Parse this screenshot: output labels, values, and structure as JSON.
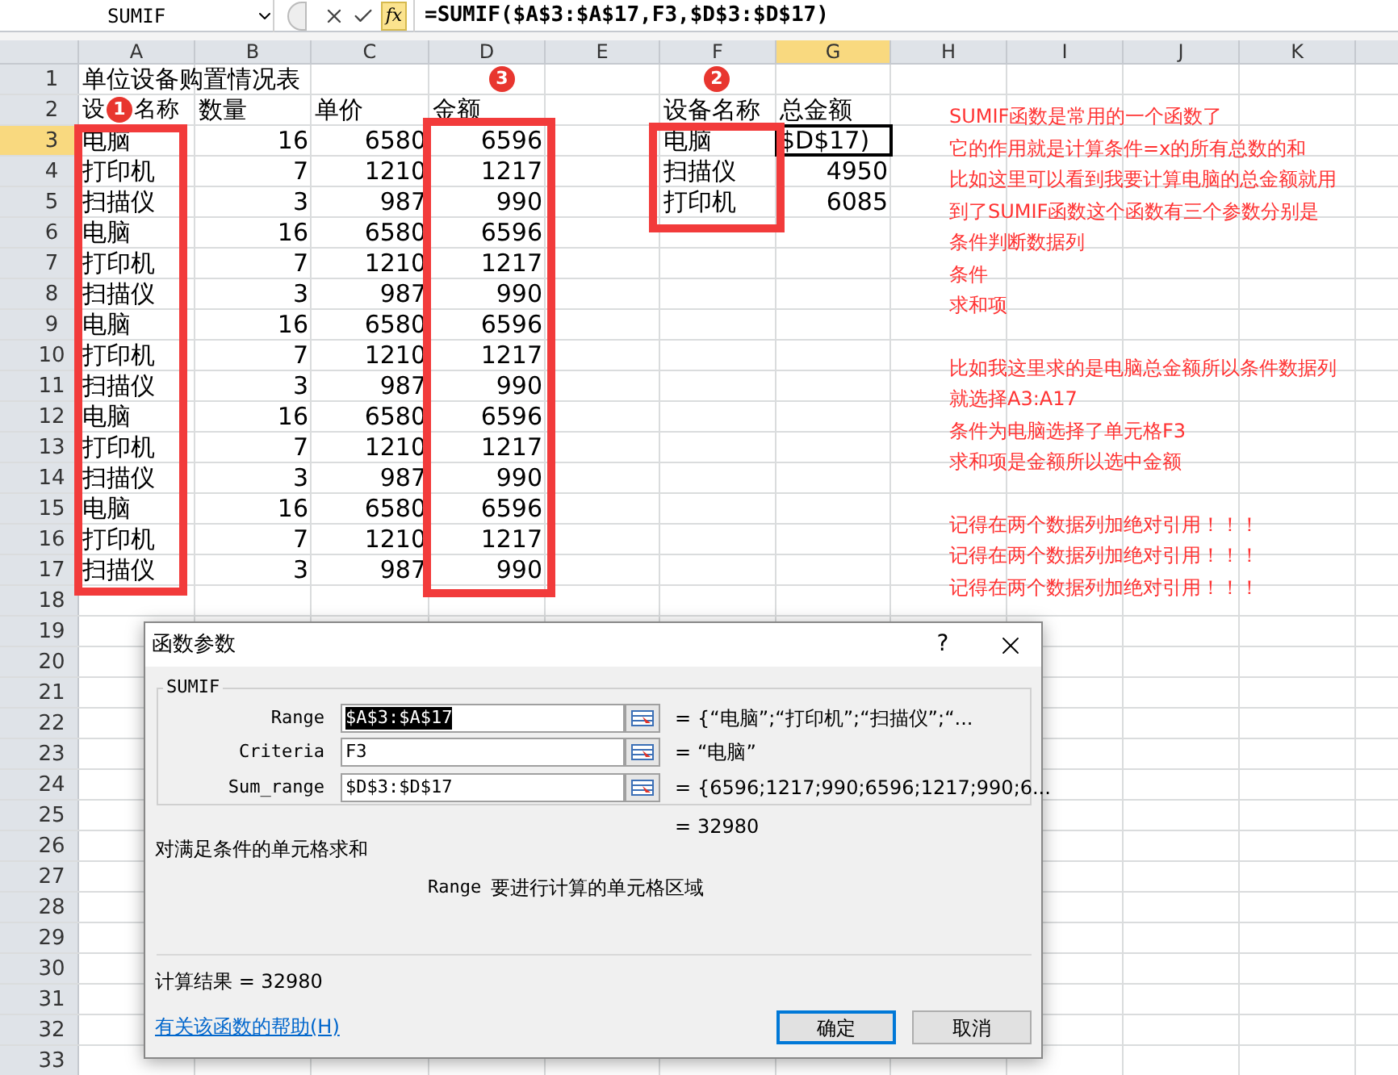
{
  "formula_bar": {
    "name_box": "SUMIF",
    "function_button": "fx",
    "formula": "=SUMIF($A$3:$A$17,F3,$D$3:$D$17)"
  },
  "sheet": {
    "columns": [
      {
        "label": "A",
        "selected": false
      },
      {
        "label": "B",
        "selected": false
      },
      {
        "label": "C",
        "selected": false
      },
      {
        "label": "D",
        "selected": false
      },
      {
        "label": "E",
        "selected": false
      },
      {
        "label": "F",
        "selected": false
      },
      {
        "label": "G",
        "selected": true
      },
      {
        "label": "H",
        "selected": false
      },
      {
        "label": "I",
        "selected": false
      },
      {
        "label": "J",
        "selected": false
      },
      {
        "label": "K",
        "selected": false
      }
    ],
    "rows": [
      {
        "number": "1",
        "selected": false,
        "A": {
          "kind": "text",
          "parts": [
            "单位设备购置情况表"
          ]
        }
      },
      {
        "number": "2",
        "selected": false,
        "A": {
          "kind": "text",
          "parts": [
            "设",
            "名称"
          ]
        },
        "B": {
          "kind": "text",
          "parts": [
            "数量"
          ]
        },
        "C": {
          "kind": "text",
          "parts": [
            "单价"
          ]
        },
        "D": {
          "kind": "text",
          "parts": [
            "金额"
          ]
        },
        "F": {
          "kind": "text",
          "parts": [
            "设备名称"
          ]
        },
        "G": {
          "kind": "text",
          "parts": [
            "总金额"
          ]
        }
      },
      {
        "number": "3",
        "selected": true,
        "A": {
          "kind": "text",
          "parts": [
            "电脑"
          ]
        },
        "B": {
          "kind": "number",
          "parts": [
            "16"
          ]
        },
        "C": {
          "kind": "number",
          "parts": [
            "6580"
          ]
        },
        "D": {
          "kind": "number",
          "parts": [
            "6596"
          ]
        },
        "F": {
          "kind": "text",
          "parts": [
            "电脑"
          ]
        },
        "G": {
          "kind": "text",
          "parts": [
            "$D$17)"
          ],
          "active": true
        }
      },
      {
        "number": "4",
        "selected": false,
        "A": {
          "kind": "text",
          "parts": [
            "打印机"
          ]
        },
        "B": {
          "kind": "number",
          "parts": [
            "7"
          ]
        },
        "C": {
          "kind": "number",
          "parts": [
            "1210"
          ]
        },
        "D": {
          "kind": "number",
          "parts": [
            "1217"
          ]
        },
        "F": {
          "kind": "text",
          "parts": [
            "扫描仪"
          ]
        },
        "G": {
          "kind": "number",
          "parts": [
            "4950"
          ]
        }
      },
      {
        "number": "5",
        "selected": false,
        "A": {
          "kind": "text",
          "parts": [
            "扫描仪"
          ]
        },
        "B": {
          "kind": "number",
          "parts": [
            "3"
          ]
        },
        "C": {
          "kind": "number",
          "parts": [
            "987"
          ]
        },
        "D": {
          "kind": "number",
          "parts": [
            "990"
          ]
        },
        "F": {
          "kind": "text",
          "parts": [
            "打印机"
          ]
        },
        "G": {
          "kind": "number",
          "parts": [
            "6085"
          ]
        }
      },
      {
        "number": "6",
        "selected": false,
        "A": {
          "kind": "text",
          "parts": [
            "电脑"
          ]
        },
        "B": {
          "kind": "number",
          "parts": [
            "16"
          ]
        },
        "C": {
          "kind": "number",
          "parts": [
            "6580"
          ]
        },
        "D": {
          "kind": "number",
          "parts": [
            "6596"
          ]
        }
      },
      {
        "number": "7",
        "selected": false,
        "A": {
          "kind": "text",
          "parts": [
            "打印机"
          ]
        },
        "B": {
          "kind": "number",
          "parts": [
            "7"
          ]
        },
        "C": {
          "kind": "number",
          "parts": [
            "1210"
          ]
        },
        "D": {
          "kind": "number",
          "parts": [
            "1217"
          ]
        }
      },
      {
        "number": "8",
        "selected": false,
        "A": {
          "kind": "text",
          "parts": [
            "扫描仪"
          ]
        },
        "B": {
          "kind": "number",
          "parts": [
            "3"
          ]
        },
        "C": {
          "kind": "number",
          "parts": [
            "987"
          ]
        },
        "D": {
          "kind": "number",
          "parts": [
            "990"
          ]
        }
      },
      {
        "number": "9",
        "selected": false,
        "A": {
          "kind": "text",
          "parts": [
            "电脑"
          ]
        },
        "B": {
          "kind": "number",
          "parts": [
            "16"
          ]
        },
        "C": {
          "kind": "number",
          "parts": [
            "6580"
          ]
        },
        "D": {
          "kind": "number",
          "parts": [
            "6596"
          ]
        }
      },
      {
        "number": "10",
        "selected": false,
        "A": {
          "kind": "text",
          "parts": [
            "打印机"
          ]
        },
        "B": {
          "kind": "number",
          "parts": [
            "7"
          ]
        },
        "C": {
          "kind": "number",
          "parts": [
            "1210"
          ]
        },
        "D": {
          "kind": "number",
          "parts": [
            "1217"
          ]
        }
      },
      {
        "number": "11",
        "selected": false,
        "A": {
          "kind": "text",
          "parts": [
            "扫描仪"
          ]
        },
        "B": {
          "kind": "number",
          "parts": [
            "3"
          ]
        },
        "C": {
          "kind": "number",
          "parts": [
            "987"
          ]
        },
        "D": {
          "kind": "number",
          "parts": [
            "990"
          ]
        }
      },
      {
        "number": "12",
        "selected": false,
        "A": {
          "kind": "text",
          "parts": [
            "电脑"
          ]
        },
        "B": {
          "kind": "number",
          "parts": [
            "16"
          ]
        },
        "C": {
          "kind": "number",
          "parts": [
            "6580"
          ]
        },
        "D": {
          "kind": "number",
          "parts": [
            "6596"
          ]
        }
      },
      {
        "number": "13",
        "selected": false,
        "A": {
          "kind": "text",
          "parts": [
            "打印机"
          ]
        },
        "B": {
          "kind": "number",
          "parts": [
            "7"
          ]
        },
        "C": {
          "kind": "number",
          "parts": [
            "1210"
          ]
        },
        "D": {
          "kind": "number",
          "parts": [
            "1217"
          ]
        }
      },
      {
        "number": "14",
        "selected": false,
        "A": {
          "kind": "text",
          "parts": [
            "扫描仪"
          ]
        },
        "B": {
          "kind": "number",
          "parts": [
            "3"
          ]
        },
        "C": {
          "kind": "number",
          "parts": [
            "987"
          ]
        },
        "D": {
          "kind": "number",
          "parts": [
            "990"
          ]
        }
      },
      {
        "number": "15",
        "selected": false,
        "A": {
          "kind": "text",
          "parts": [
            "电脑"
          ]
        },
        "B": {
          "kind": "number",
          "parts": [
            "16"
          ]
        },
        "C": {
          "kind": "number",
          "parts": [
            "6580"
          ]
        },
        "D": {
          "kind": "number",
          "parts": [
            "6596"
          ]
        }
      },
      {
        "number": "16",
        "selected": false,
        "A": {
          "kind": "text",
          "parts": [
            "打印机"
          ]
        },
        "B": {
          "kind": "number",
          "parts": [
            "7"
          ]
        },
        "C": {
          "kind": "number",
          "parts": [
            "1210"
          ]
        },
        "D": {
          "kind": "number",
          "parts": [
            "1217"
          ]
        }
      },
      {
        "number": "17",
        "selected": false,
        "A": {
          "kind": "text",
          "parts": [
            "扫描仪"
          ]
        },
        "B": {
          "kind": "number",
          "parts": [
            "3"
          ]
        },
        "C": {
          "kind": "number",
          "parts": [
            "987"
          ]
        },
        "D": {
          "kind": "number",
          "parts": [
            "990"
          ]
        }
      },
      {
        "number": "18",
        "selected": false
      },
      {
        "number": "19",
        "selected": false
      },
      {
        "number": "20",
        "selected": false
      },
      {
        "number": "21",
        "selected": false
      },
      {
        "number": "22",
        "selected": false
      },
      {
        "number": "23",
        "selected": false
      },
      {
        "number": "24",
        "selected": false
      },
      {
        "number": "25",
        "selected": false
      },
      {
        "number": "26",
        "selected": false
      },
      {
        "number": "27",
        "selected": false
      },
      {
        "number": "28",
        "selected": false
      },
      {
        "number": "29",
        "selected": false
      },
      {
        "number": "30",
        "selected": false
      },
      {
        "number": "31",
        "selected": false
      },
      {
        "number": "32",
        "selected": false
      },
      {
        "number": "33",
        "selected": false
      }
    ]
  },
  "markers": [
    {
      "label": "1"
    },
    {
      "label": "3"
    },
    {
      "label": "2"
    }
  ],
  "note": {
    "paragraphs": [
      [
        "SUMIF函数是常用的一个函数了",
        "它的作用就是计算条件=x的所有总数的和",
        "比如这里可以看到我要计算电脑的总金额就用",
        "到了SUMIF函数这个函数有三个参数分别是",
        "条件判断数据列",
        "条件",
        "求和项"
      ],
      [
        "比如我这里求的是电脑总金额所以条件数据列",
        "就选择A3:A17",
        "条件为电脑选择了单元格F3",
        "求和项是金额所以选中金额"
      ],
      [
        "记得在两个数据列加绝对引用！！！",
        "记得在两个数据列加绝对引用！！！",
        "记得在两个数据列加绝对引用！！！"
      ]
    ]
  },
  "dialog": {
    "title": "函数参数",
    "help_button": "?",
    "function_name": "SUMIF",
    "arguments": [
      {
        "label": "Range",
        "value": "$A$3:$A$17",
        "text_selected": true,
        "equals": "=",
        "result": "{“电脑”;“打印机”;“扫描仪”;“..."
      },
      {
        "label": "Criteria",
        "value": "F3",
        "text_selected": false,
        "equals": "=",
        "result": "“电脑”"
      },
      {
        "label": "Sum_range",
        "value": "$D$3:$D$17",
        "text_selected": false,
        "equals": "=",
        "result": "{6596;1217;990;6596;1217;990;6..."
      }
    ],
    "total_equals": "=",
    "total": "32980",
    "description": "对满足条件的单元格求和",
    "argument_help": {
      "name": "Range",
      "text": "要进行计算的单元格区域"
    },
    "result_line": "计算结果 = 32980",
    "help_link": "有关该函数的帮助(H)",
    "buttons": [
      {
        "label": "确定",
        "default": true
      },
      {
        "label": "取消",
        "default": false
      }
    ]
  }
}
